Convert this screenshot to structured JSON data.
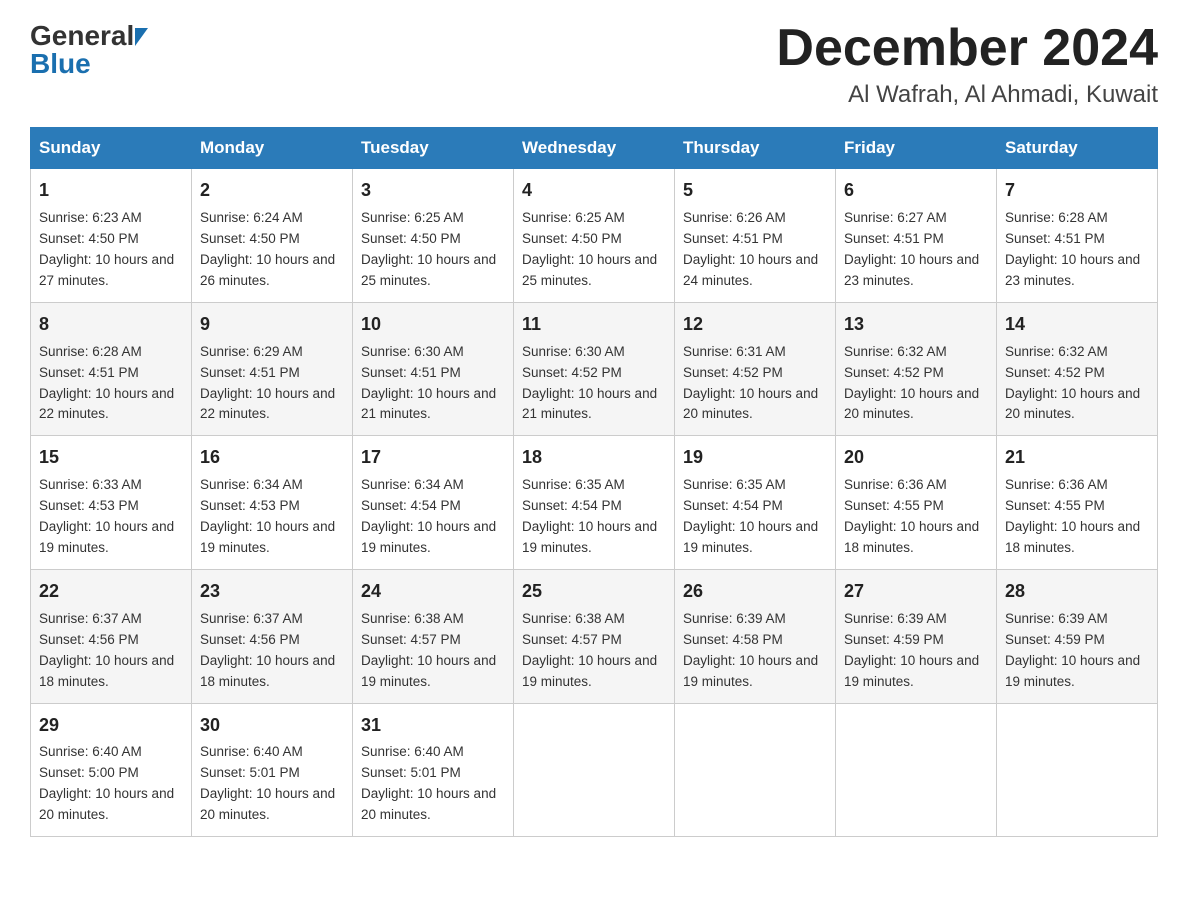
{
  "header": {
    "logo_line1": "General",
    "logo_line2": "Blue",
    "title": "December 2024",
    "subtitle": "Al Wafrah, Al Ahmadi, Kuwait"
  },
  "days_of_week": [
    "Sunday",
    "Monday",
    "Tuesday",
    "Wednesday",
    "Thursday",
    "Friday",
    "Saturday"
  ],
  "weeks": [
    [
      {
        "day": "1",
        "sunrise": "6:23 AM",
        "sunset": "4:50 PM",
        "daylight": "10 hours and 27 minutes."
      },
      {
        "day": "2",
        "sunrise": "6:24 AM",
        "sunset": "4:50 PM",
        "daylight": "10 hours and 26 minutes."
      },
      {
        "day": "3",
        "sunrise": "6:25 AM",
        "sunset": "4:50 PM",
        "daylight": "10 hours and 25 minutes."
      },
      {
        "day": "4",
        "sunrise": "6:25 AM",
        "sunset": "4:50 PM",
        "daylight": "10 hours and 25 minutes."
      },
      {
        "day": "5",
        "sunrise": "6:26 AM",
        "sunset": "4:51 PM",
        "daylight": "10 hours and 24 minutes."
      },
      {
        "day": "6",
        "sunrise": "6:27 AM",
        "sunset": "4:51 PM",
        "daylight": "10 hours and 23 minutes."
      },
      {
        "day": "7",
        "sunrise": "6:28 AM",
        "sunset": "4:51 PM",
        "daylight": "10 hours and 23 minutes."
      }
    ],
    [
      {
        "day": "8",
        "sunrise": "6:28 AM",
        "sunset": "4:51 PM",
        "daylight": "10 hours and 22 minutes."
      },
      {
        "day": "9",
        "sunrise": "6:29 AM",
        "sunset": "4:51 PM",
        "daylight": "10 hours and 22 minutes."
      },
      {
        "day": "10",
        "sunrise": "6:30 AM",
        "sunset": "4:51 PM",
        "daylight": "10 hours and 21 minutes."
      },
      {
        "day": "11",
        "sunrise": "6:30 AM",
        "sunset": "4:52 PM",
        "daylight": "10 hours and 21 minutes."
      },
      {
        "day": "12",
        "sunrise": "6:31 AM",
        "sunset": "4:52 PM",
        "daylight": "10 hours and 20 minutes."
      },
      {
        "day": "13",
        "sunrise": "6:32 AM",
        "sunset": "4:52 PM",
        "daylight": "10 hours and 20 minutes."
      },
      {
        "day": "14",
        "sunrise": "6:32 AM",
        "sunset": "4:52 PM",
        "daylight": "10 hours and 20 minutes."
      }
    ],
    [
      {
        "day": "15",
        "sunrise": "6:33 AM",
        "sunset": "4:53 PM",
        "daylight": "10 hours and 19 minutes."
      },
      {
        "day": "16",
        "sunrise": "6:34 AM",
        "sunset": "4:53 PM",
        "daylight": "10 hours and 19 minutes."
      },
      {
        "day": "17",
        "sunrise": "6:34 AM",
        "sunset": "4:54 PM",
        "daylight": "10 hours and 19 minutes."
      },
      {
        "day": "18",
        "sunrise": "6:35 AM",
        "sunset": "4:54 PM",
        "daylight": "10 hours and 19 minutes."
      },
      {
        "day": "19",
        "sunrise": "6:35 AM",
        "sunset": "4:54 PM",
        "daylight": "10 hours and 19 minutes."
      },
      {
        "day": "20",
        "sunrise": "6:36 AM",
        "sunset": "4:55 PM",
        "daylight": "10 hours and 18 minutes."
      },
      {
        "day": "21",
        "sunrise": "6:36 AM",
        "sunset": "4:55 PM",
        "daylight": "10 hours and 18 minutes."
      }
    ],
    [
      {
        "day": "22",
        "sunrise": "6:37 AM",
        "sunset": "4:56 PM",
        "daylight": "10 hours and 18 minutes."
      },
      {
        "day": "23",
        "sunrise": "6:37 AM",
        "sunset": "4:56 PM",
        "daylight": "10 hours and 18 minutes."
      },
      {
        "day": "24",
        "sunrise": "6:38 AM",
        "sunset": "4:57 PM",
        "daylight": "10 hours and 19 minutes."
      },
      {
        "day": "25",
        "sunrise": "6:38 AM",
        "sunset": "4:57 PM",
        "daylight": "10 hours and 19 minutes."
      },
      {
        "day": "26",
        "sunrise": "6:39 AM",
        "sunset": "4:58 PM",
        "daylight": "10 hours and 19 minutes."
      },
      {
        "day": "27",
        "sunrise": "6:39 AM",
        "sunset": "4:59 PM",
        "daylight": "10 hours and 19 minutes."
      },
      {
        "day": "28",
        "sunrise": "6:39 AM",
        "sunset": "4:59 PM",
        "daylight": "10 hours and 19 minutes."
      }
    ],
    [
      {
        "day": "29",
        "sunrise": "6:40 AM",
        "sunset": "5:00 PM",
        "daylight": "10 hours and 20 minutes."
      },
      {
        "day": "30",
        "sunrise": "6:40 AM",
        "sunset": "5:01 PM",
        "daylight": "10 hours and 20 minutes."
      },
      {
        "day": "31",
        "sunrise": "6:40 AM",
        "sunset": "5:01 PM",
        "daylight": "10 hours and 20 minutes."
      },
      null,
      null,
      null,
      null
    ]
  ],
  "labels": {
    "sunrise": "Sunrise:",
    "sunset": "Sunset:",
    "daylight": "Daylight:"
  }
}
